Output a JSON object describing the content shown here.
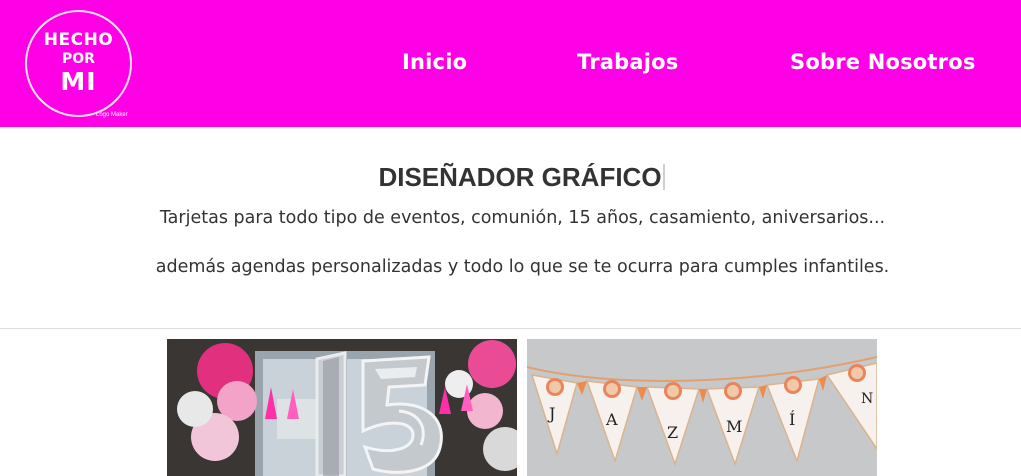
{
  "header": {
    "logo": {
      "line1": "HECHO",
      "line2": "POR",
      "line3": "MI",
      "credit": "Logo Maker"
    },
    "nav": [
      {
        "label": "Inicio"
      },
      {
        "label": "Trabajos"
      },
      {
        "label": "Sobre Nosotros"
      }
    ],
    "background_color": "#ff00e6"
  },
  "hero": {
    "title": "DISEÑADOR GRÁFICO",
    "text1": "Tarjetas para todo tipo de eventos, comunión, 15 años, casamiento, aniversarios...",
    "text2": "además agendas personalizadas y todo lo que se te ocurra para cumples infantiles."
  },
  "gallery": {
    "images": [
      {
        "label": "15",
        "description_icon": "balloon-15-photo"
      },
      {
        "letters": [
          "J",
          "A",
          "Z",
          "M",
          "Í",
          "N"
        ],
        "description_icon": "bunting-banner-photo"
      }
    ]
  }
}
